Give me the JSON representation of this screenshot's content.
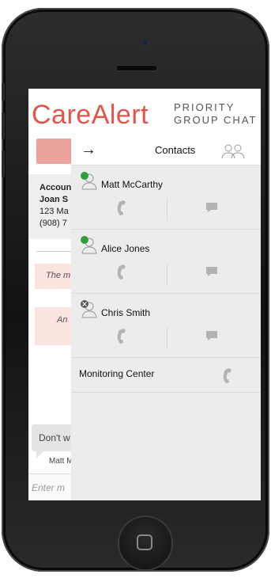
{
  "header": {
    "logo": "CareAlert",
    "tagline_line1": "PRIORITY",
    "tagline_line2": "GROUP CHAT"
  },
  "account": {
    "label": "Accoun",
    "name": "Joan S",
    "address": "123 Ma",
    "phone": "(908) 7"
  },
  "messages": [
    {
      "text": "The m"
    },
    {
      "text": "An"
    }
  ],
  "incoming": {
    "text": "Don't w",
    "sender": "Matt M"
  },
  "compose": {
    "placeholder": "Enter m"
  },
  "contacts_panel": {
    "title": "Contacts",
    "contacts": [
      {
        "name": "Matt McCarthy",
        "status": "online"
      },
      {
        "name": "Alice Jones",
        "status": "online"
      },
      {
        "name": "Chris Smith",
        "status": "unavailable"
      }
    ],
    "monitoring": {
      "label": "Monitoring Center"
    }
  },
  "colors": {
    "brand": "#e2554a",
    "online": "#2f9e3e",
    "unavailable": "#555555",
    "panel_bg": "#ececec",
    "icon": "#b3b3b3"
  },
  "icons": {
    "back": "right-arrow-icon",
    "group": "group-icon",
    "call": "phone-icon",
    "chat": "chat-bubble-icon"
  }
}
